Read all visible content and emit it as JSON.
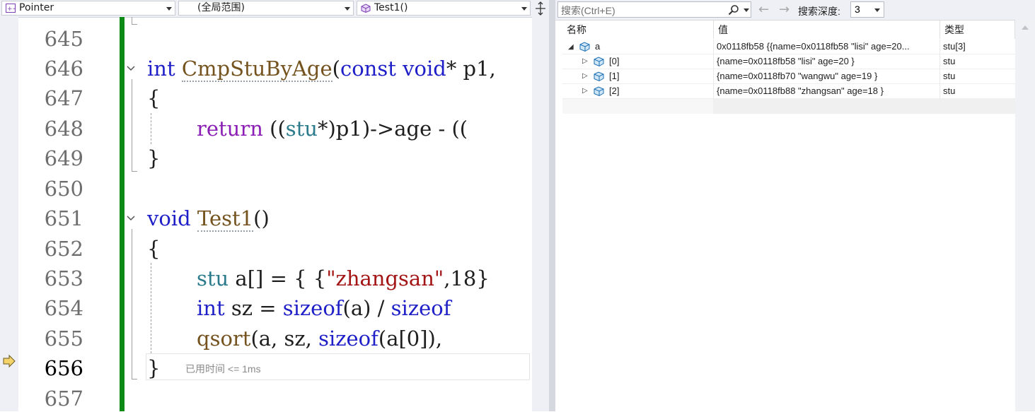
{
  "navbar": {
    "project": "Pointer",
    "scope": "(全局范围)",
    "member": "Test1()"
  },
  "editor": {
    "line_numbers": [
      "645",
      "646",
      "647",
      "648",
      "649",
      "650",
      "651",
      "652",
      "653",
      "654",
      "655",
      "656",
      "657"
    ],
    "current_line": "656",
    "lines": {
      "l646": {
        "kw1": "int",
        "fn": "CmpStuByAge",
        "p1": "(",
        "kw2": "const",
        "sp": " ",
        "kw3": "void",
        "rest": "* p1,"
      },
      "l647": {
        "text": "{"
      },
      "l648": {
        "kw": "return",
        "a": " ((",
        "ty": "stu",
        "b": "*)p1)->age - (("
      },
      "l649": {
        "text": "}"
      },
      "l651": {
        "kw": "void",
        "fn": "Test1",
        "rest": "()"
      },
      "l652": {
        "text": "{"
      },
      "l653": {
        "ty": "stu",
        "a": " a[] = { {",
        "str": "\"zhangsan\"",
        "b": ",18}"
      },
      "l654": {
        "kw": "int",
        "a": " sz = ",
        "kw2": "sizeof",
        "b": "(a) / ",
        "kw3": "sizeof"
      },
      "l655": {
        "fn": "qsort",
        "a": "(a, sz, ",
        "kw": "sizeof",
        "b": "(a[0]),"
      },
      "l656": {
        "text": "}"
      }
    },
    "elapsed": "已用时间 <= 1ms"
  },
  "watch": {
    "search_placeholder": "搜索(Ctrl+E)",
    "depth_label": "搜索深度:",
    "depth_value": "3",
    "columns": {
      "name": "名称",
      "value": "值",
      "type": "类型"
    },
    "rows": [
      {
        "name": "a",
        "value": "0x0118fb58 {{name=0x0118fb58 \"lisi\" age=20...",
        "type": "stu[3]",
        "expanded": true
      },
      {
        "name": "[0]",
        "value": "{name=0x0118fb58 \"lisi\" age=20 }",
        "type": "stu",
        "expanded": false
      },
      {
        "name": "[1]",
        "value": "{name=0x0118fb70 \"wangwu\" age=19 }",
        "type": "stu",
        "expanded": false
      },
      {
        "name": "[2]",
        "value": "{name=0x0118fb88 \"zhangsan\" age=18 }",
        "type": "stu",
        "expanded": false
      }
    ]
  },
  "colors": {
    "change_bar": "#0e8a16",
    "keyword": "#1f1fc8",
    "control_keyword": "#8b1fb5",
    "function": "#74531f",
    "type": "#2b7b8c",
    "string": "#a31515"
  }
}
